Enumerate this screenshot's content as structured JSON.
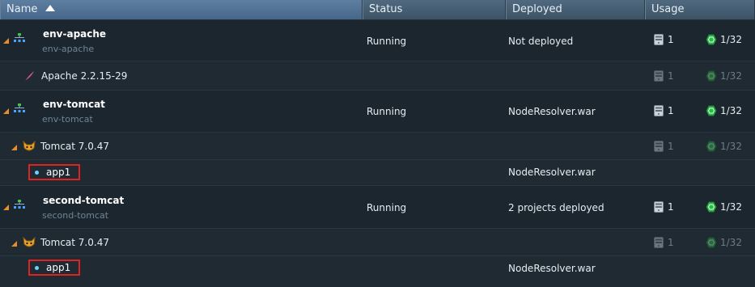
{
  "columns": {
    "name": "Name",
    "status": "Status",
    "deployed": "Deployed",
    "usage": "Usage"
  },
  "rows": [
    {
      "name": "env-apache",
      "sub": "env-apache",
      "status": "Running",
      "deployed": "Not deployed",
      "cloudlets": "1",
      "ratio": "1/32"
    },
    {
      "name": "Apache 2.2.15-29",
      "cloudlets": "1",
      "ratio": "1/32"
    },
    {
      "name": "env-tomcat",
      "sub": "env-tomcat",
      "status": "Running",
      "deployed": "NodeResolver.war",
      "cloudlets": "1",
      "ratio": "1/32"
    },
    {
      "name": "Tomcat 7.0.47",
      "cloudlets": "1",
      "ratio": "1/32"
    },
    {
      "name": "app1",
      "deployed": "NodeResolver.war"
    },
    {
      "name": "second-tomcat",
      "sub": "second-tomcat",
      "status": "Running",
      "deployed": "2 projects deployed",
      "cloudlets": "1",
      "ratio": "1/32"
    },
    {
      "name": "Tomcat 7.0.47",
      "cloudlets": "1",
      "ratio": "1/32"
    },
    {
      "name": "app1",
      "deployed": "NodeResolver.war"
    }
  ]
}
